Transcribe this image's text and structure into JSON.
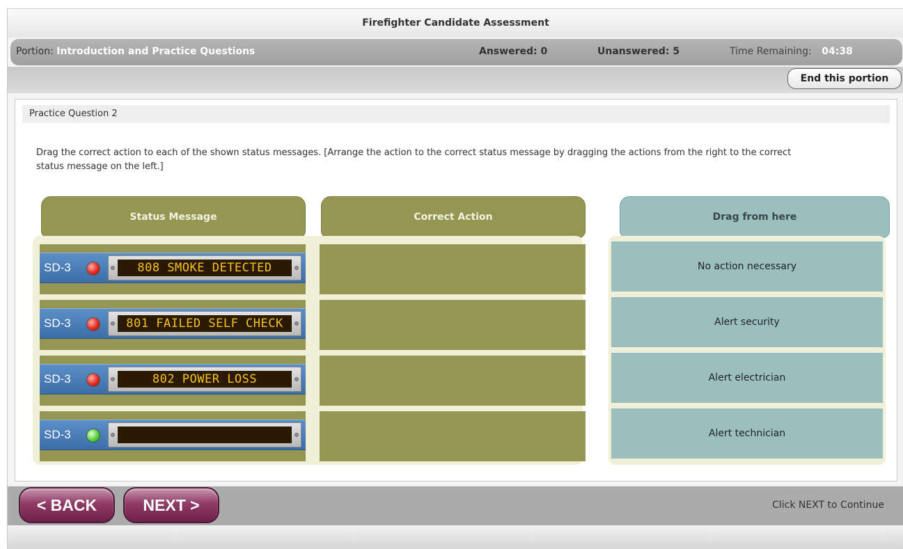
{
  "app": {
    "title": "Firefighter Candidate Assessment"
  },
  "status": {
    "portion_label": "Portion:",
    "portion_value": "Introduction and Practice Questions",
    "answered": "Answered: 0",
    "unanswered": "Unanswered: 5",
    "time_label": "Time Remaining:",
    "time_value": "04:38"
  },
  "toolbar": {
    "end_label": "End this portion"
  },
  "question": {
    "header": "Practice Question 2",
    "instructions": "Drag the correct action to each of the shown status messages.  [Arrange the action to the correct status message by dragging the actions from the right to the correct status message on the left.]"
  },
  "columns": {
    "status_message": "Status Message",
    "correct_action": "Correct Action",
    "drag_from_here": "Drag from here"
  },
  "status_messages": [
    {
      "device": "SD-3",
      "led": "red",
      "text": "808 SMOKE DETECTED"
    },
    {
      "device": "SD-3",
      "led": "red",
      "text": "801 FAILED SELF CHECK"
    },
    {
      "device": "SD-3",
      "led": "red",
      "text": "802 POWER LOSS"
    },
    {
      "device": "SD-3",
      "led": "green",
      "text": ""
    }
  ],
  "actions": [
    {
      "label": "No action necessary"
    },
    {
      "label": "Alert security"
    },
    {
      "label": "Alert electrician"
    },
    {
      "label": "Alert technician"
    }
  ],
  "footer": {
    "back_label": "< BACK",
    "next_label": "NEXT >",
    "hint": "Click NEXT to Continue"
  },
  "colors": {
    "olive": "#959652",
    "teal": "#9bbfbf",
    "nav_button": "#8f3b66",
    "lcd_text": "#f7c21d"
  }
}
